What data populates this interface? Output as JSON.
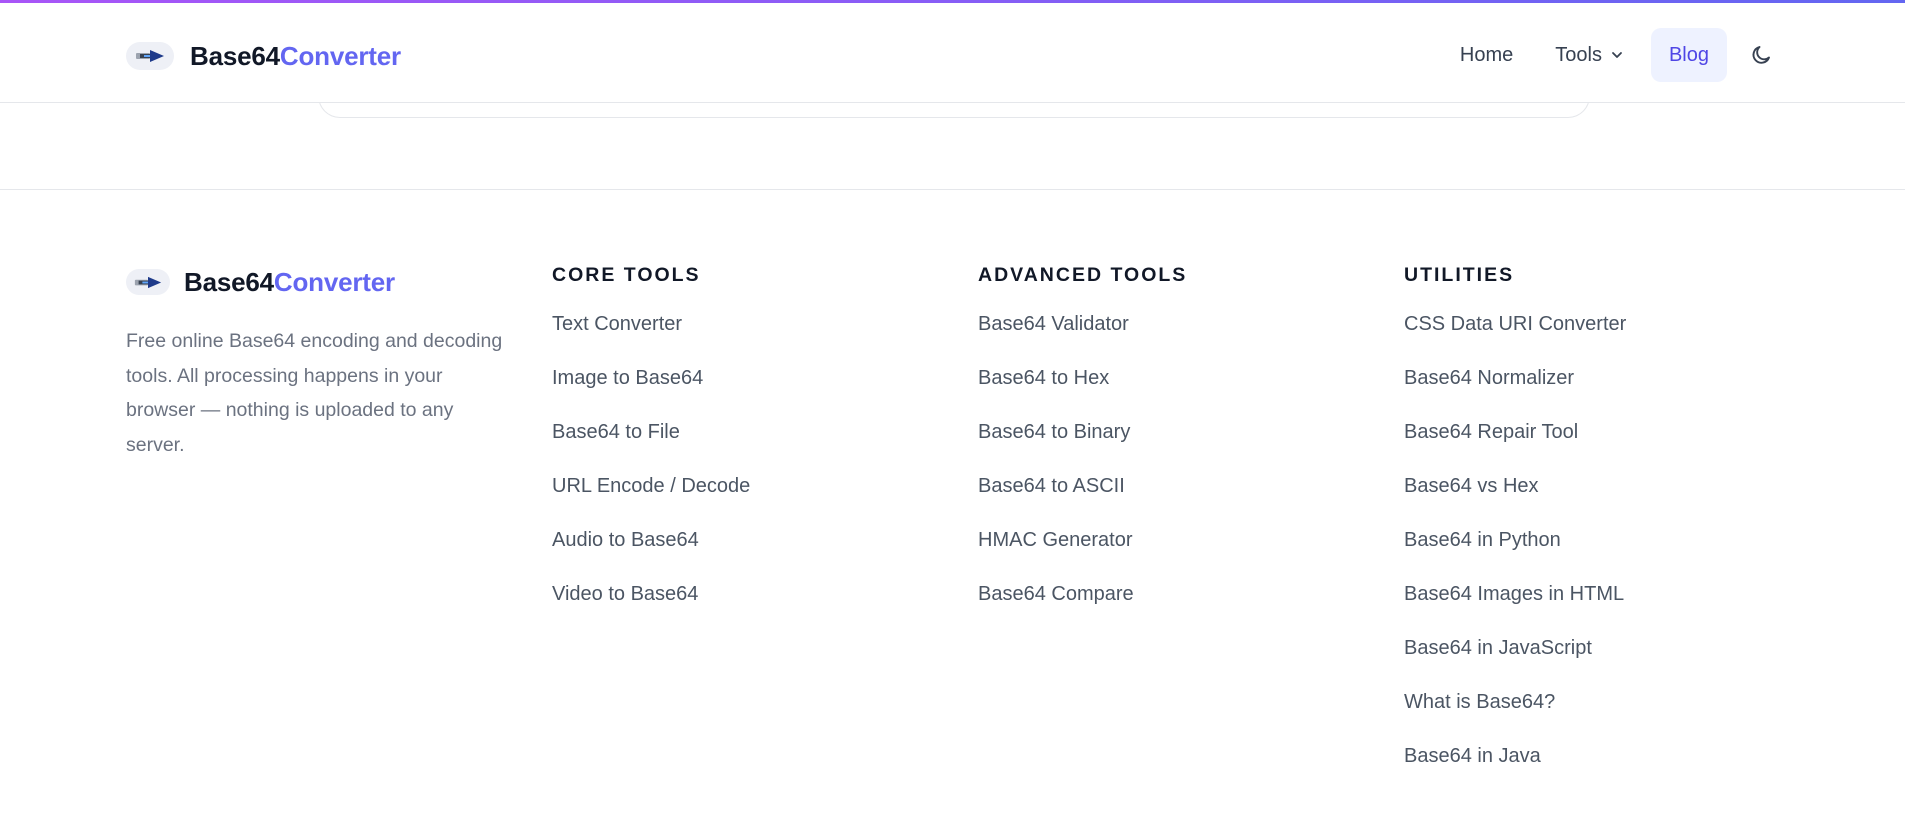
{
  "header": {
    "brand_part1": "Base64",
    "brand_part2": "Converter",
    "nav": {
      "home": "Home",
      "tools": "Tools",
      "blog": "Blog"
    }
  },
  "footer": {
    "brand_part1": "Base64",
    "brand_part2": "Converter",
    "description": "Free online Base64 encoding and decoding tools. All processing happens in your browser — nothing is uploaded to any server.",
    "columns": [
      {
        "title": "CORE TOOLS",
        "links": [
          "Text Converter",
          "Image to Base64",
          "Base64 to File",
          "URL Encode / Decode",
          "Audio to Base64",
          "Video to Base64"
        ]
      },
      {
        "title": "ADVANCED TOOLS",
        "links": [
          "Base64 Validator",
          "Base64 to Hex",
          "Base64 to Binary",
          "Base64 to ASCII",
          "HMAC Generator",
          "Base64 Compare"
        ]
      },
      {
        "title": "UTILITIES",
        "links": [
          "CSS Data URI Converter",
          "Base64 Normalizer",
          "Base64 Repair Tool",
          "Base64 vs Hex",
          "Base64 in Python",
          "Base64 Images in HTML",
          "Base64 in JavaScript",
          "What is Base64?",
          "Base64 in Java"
        ]
      }
    ]
  },
  "icons": {
    "logo": "logo-icon",
    "tools_dropdown": "chevron-down-icon",
    "theme_toggle": "moon-icon"
  },
  "colors": {
    "accent": "#6366f1",
    "accent_top_bar": "#a855f7",
    "blog_bg": "#eef2ff",
    "text_dark": "#111827",
    "text_muted": "#6b7280"
  }
}
